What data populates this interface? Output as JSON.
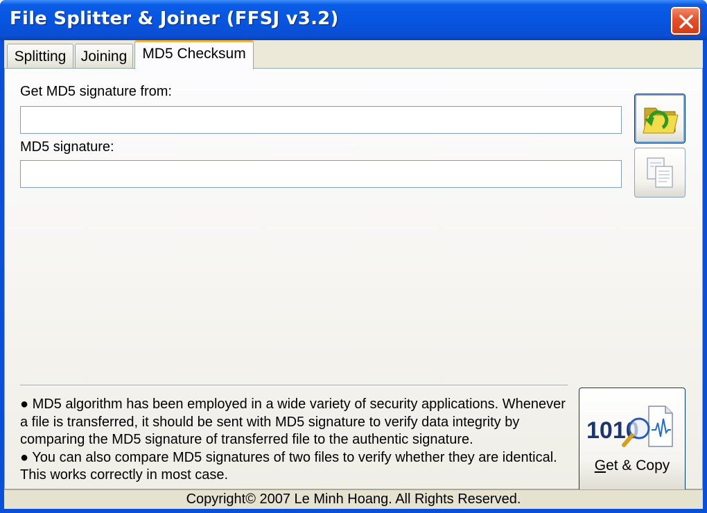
{
  "window": {
    "title": "File Splitter & Joiner (FFSJ v3.2)"
  },
  "tabs": [
    {
      "label": "Splitting",
      "active": false
    },
    {
      "label": "Joining",
      "active": false
    },
    {
      "label": "MD5 Checksum",
      "active": true
    }
  ],
  "md5": {
    "source_label": "Get MD5 signature from:",
    "source_value": "",
    "signature_label": "MD5 signature:",
    "signature_value": "",
    "browse_icon": "open-folder-icon",
    "copy_icon": "copy-icon"
  },
  "info": {
    "paragraph1": "● MD5 algorithm has been employed in a wide variety of security applications. Whenever a file is transferred, it should be sent with MD5 signature to verify data integrity by comparing the MD5 signature of transferred file to the authentic signature.",
    "paragraph2": "● You can also compare MD5 signatures of two files to verify whether they are identical. This works correctly in most case."
  },
  "action": {
    "label_accel": "G",
    "label_rest": "et & Copy",
    "icon_text": "1010",
    "icon": "binary-magnifier-icon"
  },
  "status": {
    "copyright": "Copyright© 2007 Le Minh Hoang. All Rights Reserved."
  },
  "colors": {
    "titlebar": "#0755e0",
    "close": "#d53d18",
    "active_tab_accent": "#f6b33a",
    "panel": "#ece9d8"
  }
}
